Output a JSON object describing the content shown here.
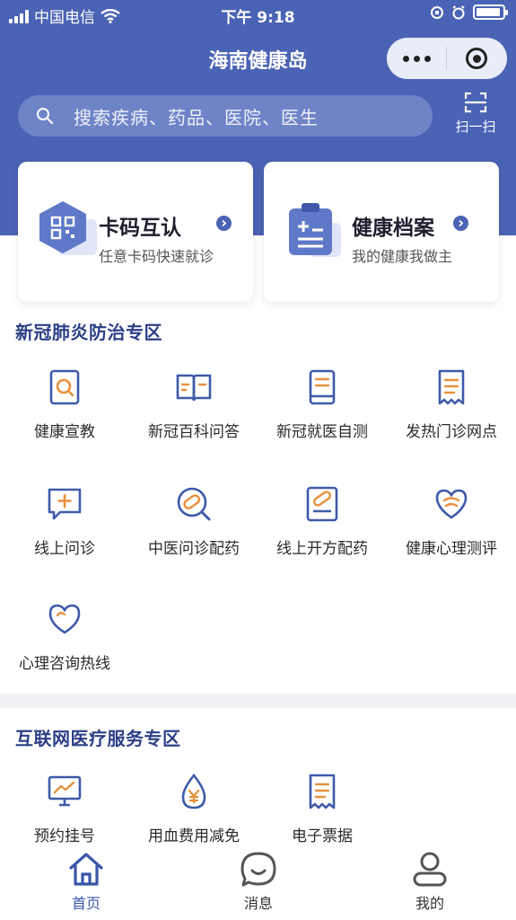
{
  "status_bar": {
    "carrier": "中国电信",
    "time": "下午 9:18"
  },
  "header": {
    "title": "海南健康岛",
    "accent": "#4a63b4"
  },
  "search": {
    "placeholder": "搜索疾病、药品、医院、医生"
  },
  "scan": {
    "label": "扫一扫"
  },
  "cards": [
    {
      "title": "卡码互认",
      "subtitle": "任意卡码快速就诊",
      "icon": "qr-code-icon"
    },
    {
      "title": "健康档案",
      "subtitle": "我的健康我做主",
      "icon": "health-record-icon"
    }
  ],
  "covid_section": {
    "title": "新冠肺炎防治专区",
    "items": [
      {
        "label": "健康宣教",
        "icon": "search-document-icon"
      },
      {
        "label": "新冠百科问答",
        "icon": "open-book-icon"
      },
      {
        "label": "新冠就医自测",
        "icon": "manual-book-icon"
      },
      {
        "label": "发热门诊网点",
        "icon": "receipt-icon"
      },
      {
        "label": "线上问诊",
        "icon": "chat-plus-icon"
      },
      {
        "label": "中医问诊配药",
        "icon": "pill-search-icon"
      },
      {
        "label": "线上开方配药",
        "icon": "prescription-icon"
      },
      {
        "label": "健康心理测评",
        "icon": "heart-stethoscope-icon"
      },
      {
        "label": "心理咨询热线",
        "icon": "heart-icon"
      }
    ]
  },
  "internet_section": {
    "title": "互联网医疗服务专区",
    "items": [
      {
        "label": "预约挂号",
        "icon": "monitor-chart-icon"
      },
      {
        "label": "用血费用减免",
        "icon": "blood-drop-yen-icon"
      },
      {
        "label": "电子票据",
        "icon": "e-receipt-icon"
      }
    ]
  },
  "tabbar": {
    "tabs": [
      {
        "label": "首页",
        "icon": "home-icon",
        "active": true
      },
      {
        "label": "消息",
        "icon": "message-icon",
        "active": false
      },
      {
        "label": "我的",
        "icon": "user-icon",
        "active": false
      }
    ]
  }
}
